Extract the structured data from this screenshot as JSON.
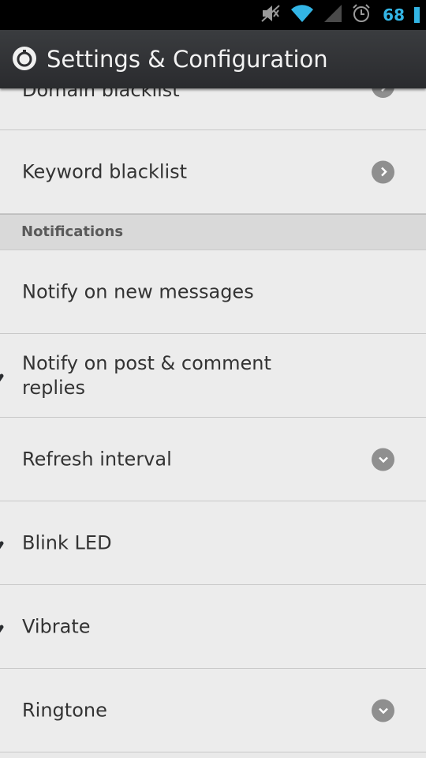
{
  "status_bar": {
    "icons": [
      "mute-icon",
      "wifi-icon",
      "signal-icon",
      "alarm-icon"
    ],
    "battery": "68"
  },
  "action_bar": {
    "icon": "settings-gear-icon",
    "title": "Settings & Configuration"
  },
  "rows_top": [
    {
      "label": "Domain blacklist",
      "control": "chevron-right-icon"
    },
    {
      "label": "Keyword blacklist",
      "control": "chevron-right-icon"
    }
  ],
  "section": {
    "label": "Notifications"
  },
  "rows_notifications": [
    {
      "label": "Notify on new messages",
      "control": "checkbox",
      "checked": false
    },
    {
      "label": "Notify on post & comment replies",
      "control": "checkbox",
      "checked": true
    },
    {
      "label": "Refresh interval",
      "control": "chevron-down-icon"
    },
    {
      "label": "Blink LED",
      "control": "checkbox",
      "checked": true
    },
    {
      "label": "Vibrate",
      "control": "checkbox",
      "checked": true
    },
    {
      "label": "Ringtone",
      "control": "chevron-down-icon"
    }
  ],
  "colors": {
    "status_bar_bg": "#000000",
    "status_accent": "#33b5e5",
    "action_bar_bg": "#2f3033",
    "list_bg": "#ececec",
    "section_bg": "#d9d9d9",
    "checkbox_bg": "#a8b6c6"
  }
}
